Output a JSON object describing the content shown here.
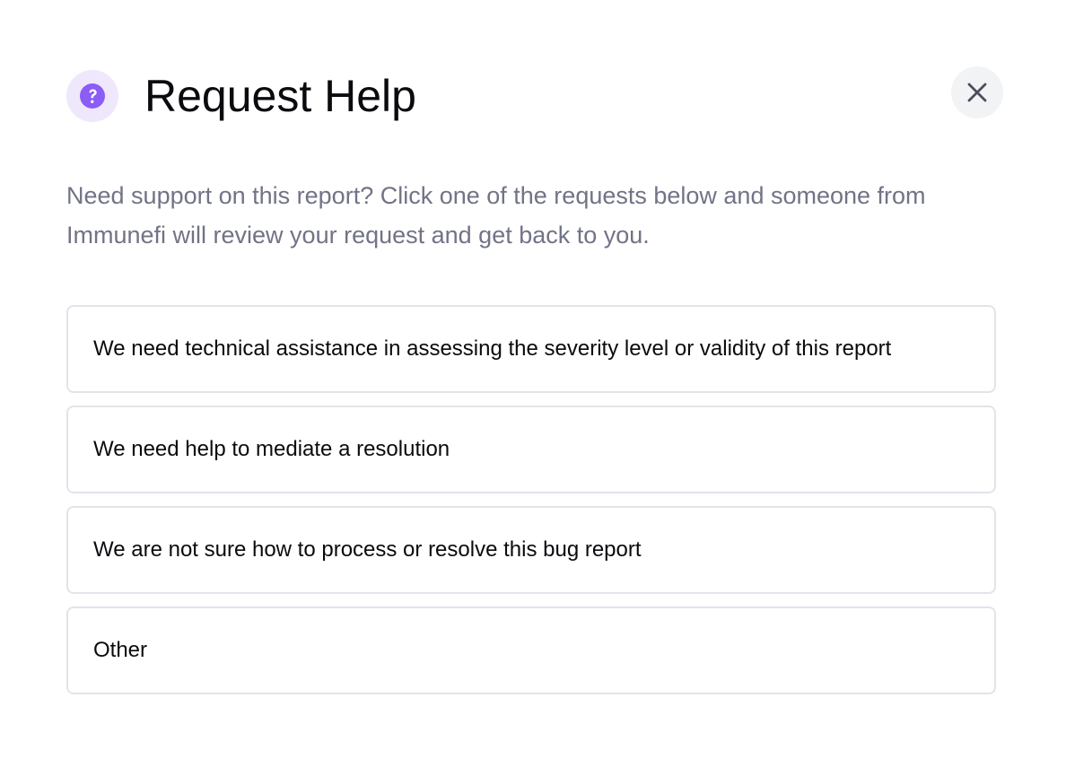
{
  "modal": {
    "title": "Request Help",
    "description": "Need support on this report? Click one of the requests below and someone from Immunefi will review your request and get back to you.",
    "icons": {
      "header": "question-circle-icon",
      "close": "close-icon"
    },
    "colors": {
      "accent": "#8b5cf6",
      "accent_soft": "#efe7fb",
      "description": "#717386",
      "border": "#e3e4ea",
      "close_background": "#f2f3f5"
    },
    "options": [
      {
        "label": "We need technical assistance in assessing the severity level or validity of this report"
      },
      {
        "label": "We need help to mediate a resolution"
      },
      {
        "label": "We are not sure how to process or resolve this bug report"
      },
      {
        "label": "Other"
      }
    ]
  }
}
